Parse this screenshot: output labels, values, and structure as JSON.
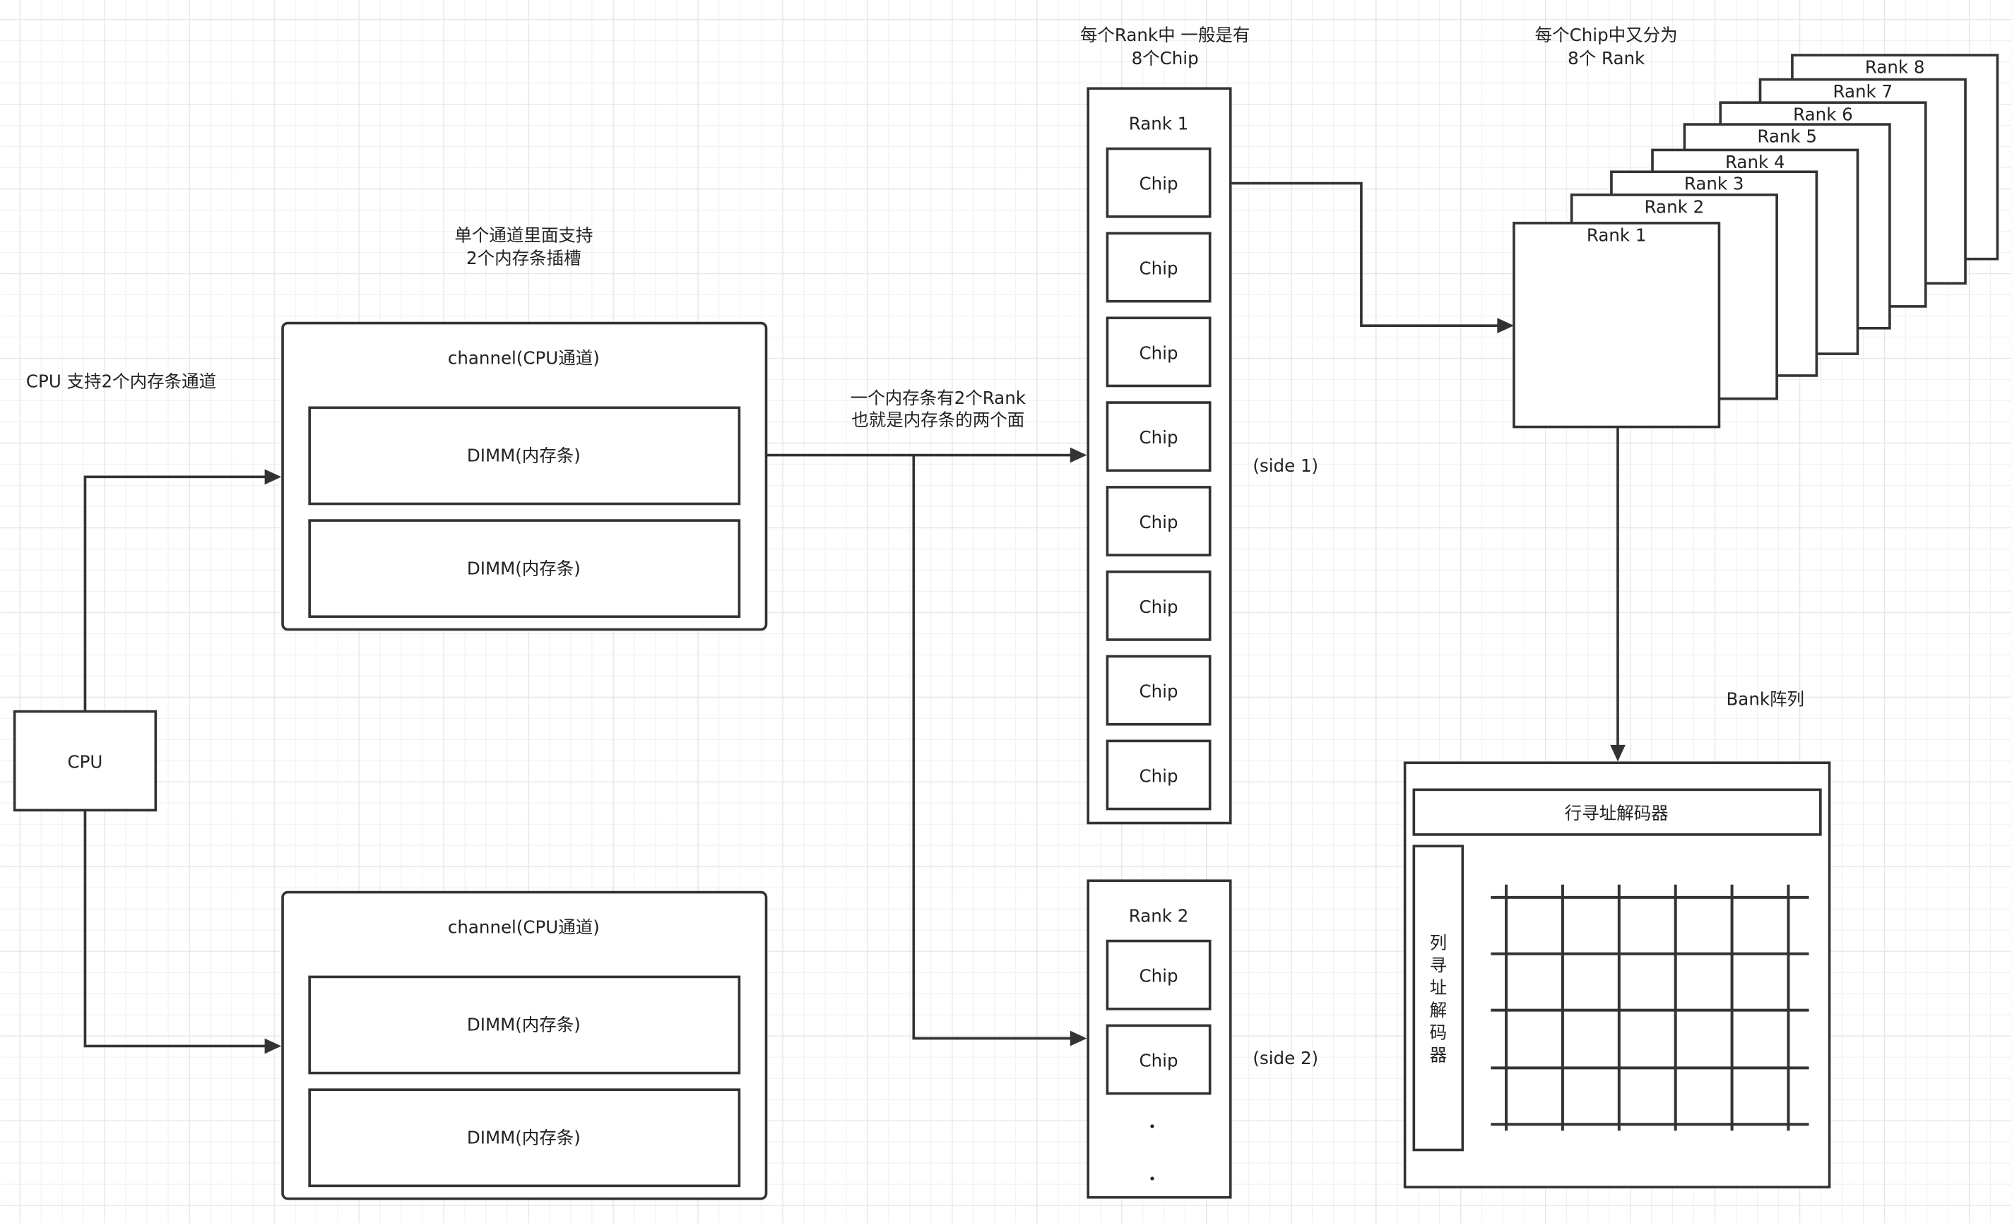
{
  "colors": {
    "stroke": "#333333",
    "grid_minor": "#f2f2f2",
    "grid_major": "#e6e6e6",
    "background": "#ffffff"
  },
  "cpu": {
    "label": "CPU",
    "note": "CPU 支持2个内存条通道"
  },
  "channel_note": [
    "单个通道里面支持",
    "2个内存条插槽"
  ],
  "channels": [
    {
      "title": "channel(CPU通道)",
      "dimms": [
        "DIMM(内存条)",
        "DIMM(内存条)"
      ]
    },
    {
      "title": "channel(CPU通道)",
      "dimms": [
        "DIMM(内存条)",
        "DIMM(内存条)"
      ]
    }
  ],
  "dimm_note": [
    "一个内存条有2个Rank",
    "也就是内存条的两个面"
  ],
  "rank_note": [
    "每个Rank中 一般是有",
    "8个Chip"
  ],
  "rank1": {
    "title": "Rank 1",
    "chips": [
      "Chip",
      "Chip",
      "Chip",
      "Chip",
      "Chip",
      "Chip",
      "Chip",
      "Chip"
    ],
    "side": "(side 1)"
  },
  "rank2": {
    "title": "Rank 2",
    "chips": [
      "Chip",
      "Chip"
    ],
    "side": "(side 2)",
    "ellipsis": [
      "•",
      "•"
    ]
  },
  "chip_note": [
    "每个Chip中又分为",
    "8个 Rank"
  ],
  "chip_ranks": [
    "Rank 1",
    "Rank 2",
    "Rank 3",
    "Rank 4",
    "Rank 5",
    "Rank 6",
    "Rank 7",
    "Rank 8"
  ],
  "bank": {
    "label": "Bank阵列",
    "row_decoder": "行寻址解码器",
    "col_decoder": "列寻址解码器"
  }
}
